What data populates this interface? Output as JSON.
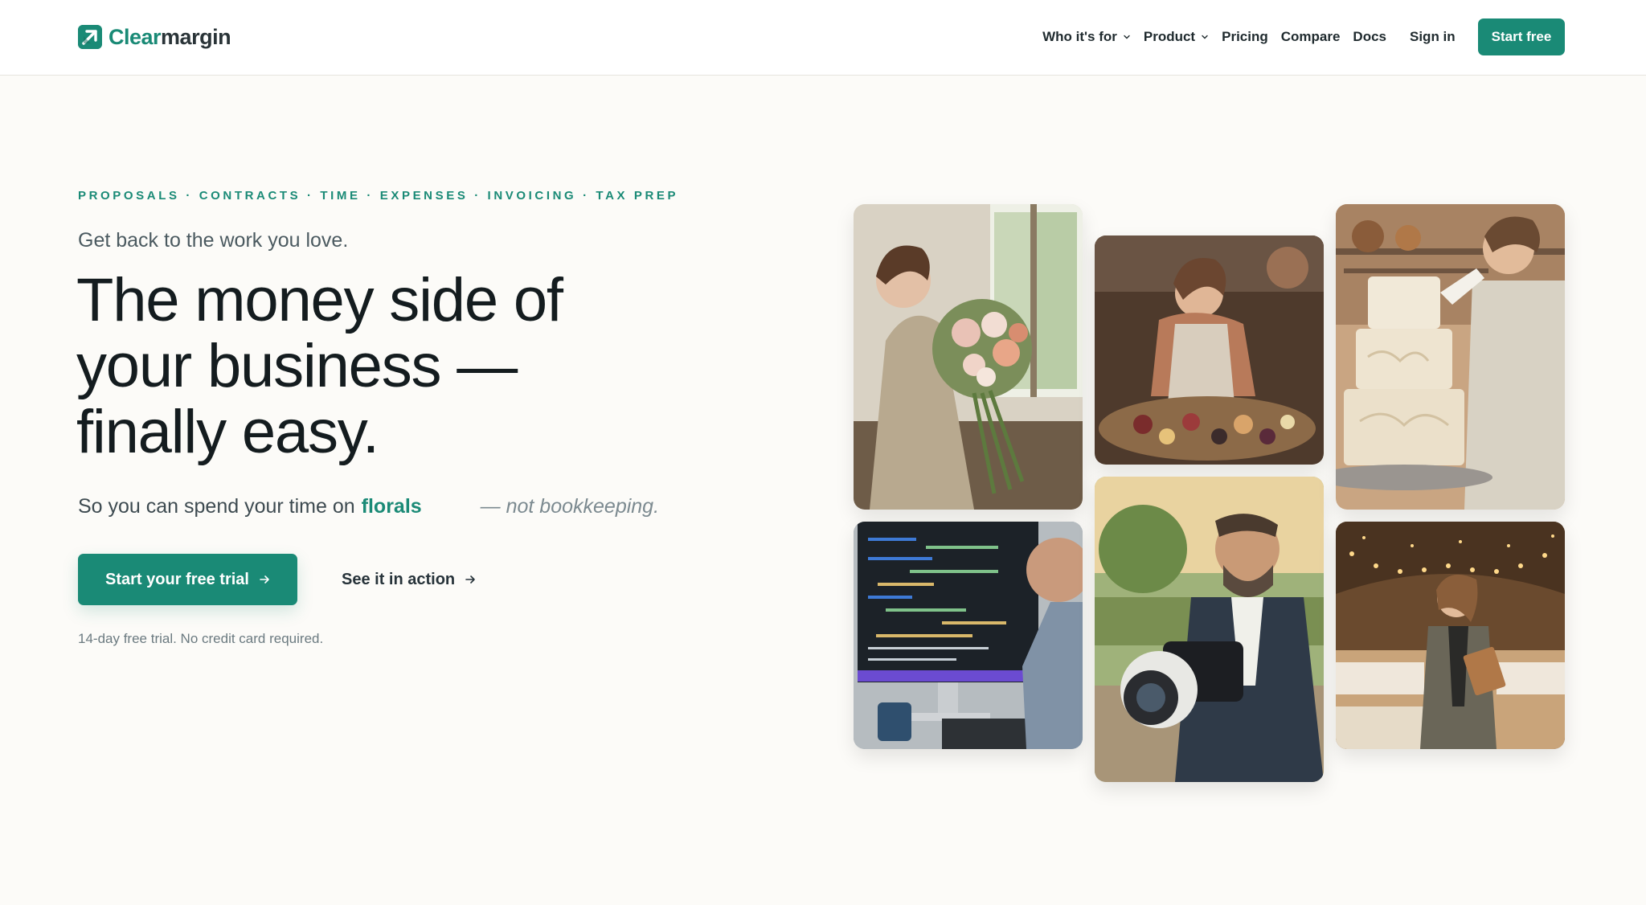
{
  "brand": {
    "name_part1": "Clear",
    "name_part2": "margin",
    "logo_icon": "arrow-up-right-icon",
    "accent_color": "#1a8a76"
  },
  "nav": {
    "items": [
      {
        "label": "Who it's for",
        "has_dropdown": true
      },
      {
        "label": "Product",
        "has_dropdown": true
      },
      {
        "label": "Pricing",
        "has_dropdown": false
      },
      {
        "label": "Compare",
        "has_dropdown": false
      },
      {
        "label": "Docs",
        "has_dropdown": false
      }
    ],
    "sign_in": "Sign in",
    "cta": "Start free"
  },
  "hero": {
    "eyebrow": "PROPOSALS · CONTRACTS · TIME · EXPENSES · INVOICING · TAX PREP",
    "kicker": "Get back to the work you love.",
    "headline_line1": "The money side of",
    "headline_line2": "your business —",
    "headline_line3": "finally easy.",
    "sub_prefix": "So you can spend your time on",
    "sub_rotating_word": "florals",
    "sub_suffix": "— not bookkeeping.",
    "cta_primary": "Start your free trial",
    "cta_secondary": "See it in action",
    "fineprint": "14-day free trial. No credit card required."
  },
  "photos": [
    {
      "subject": "florist arranging a bouquet"
    },
    {
      "subject": "caterer preparing a charcuterie board"
    },
    {
      "subject": "baker piping a tiered cake"
    },
    {
      "subject": "developer coding at a monitor"
    },
    {
      "subject": "photographer checking a camera"
    },
    {
      "subject": "event planner with a clipboard"
    }
  ]
}
